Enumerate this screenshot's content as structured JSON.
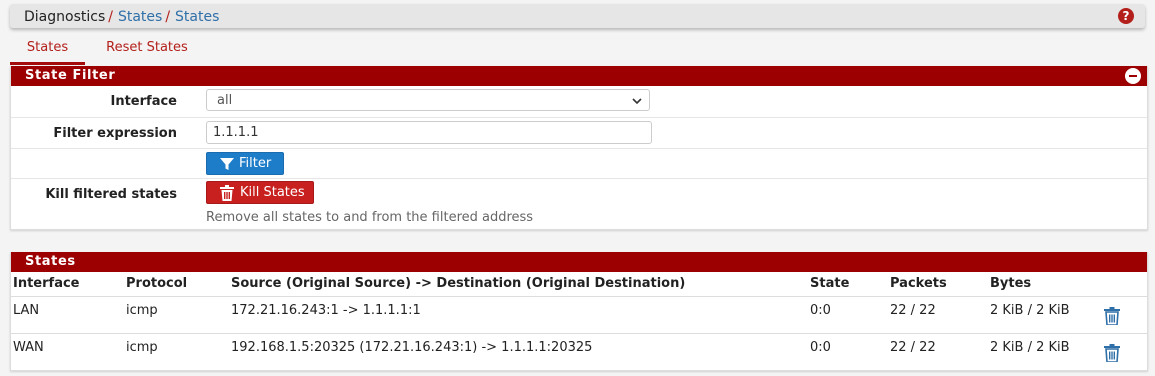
{
  "breadcrumb": {
    "items": [
      "Diagnostics",
      "States",
      "States"
    ],
    "separator": "/"
  },
  "tabs": [
    "States",
    "Reset States"
  ],
  "state_filter": {
    "title": "State Filter",
    "interface_label": "Interface",
    "interface_value": "all",
    "filter_label": "Filter expression",
    "filter_value": "1.1.1.1",
    "filter_button": "Filter",
    "kill_label": "Kill filtered states",
    "kill_button": "Kill States",
    "kill_help": "Remove all states to and from the filtered address"
  },
  "states": {
    "title": "States",
    "columns": [
      "Interface",
      "Protocol",
      "Source (Original Source) -> Destination (Original Destination)",
      "State",
      "Packets",
      "Bytes"
    ],
    "rows": [
      {
        "interface": "LAN",
        "protocol": "icmp",
        "flow": "172.21.16.243:1 -> 1.1.1.1:1",
        "state": "0:0",
        "packets": "22 / 22",
        "bytes": "2 KiB / 2 KiB"
      },
      {
        "interface": "WAN",
        "protocol": "icmp",
        "flow": "192.168.1.5:20325 (172.21.16.243:1) -> 1.1.1.1:20325",
        "state": "0:0",
        "packets": "22 / 22",
        "bytes": "2 KiB / 2 KiB"
      }
    ]
  },
  "colors": {
    "panel_header": "#9c0000",
    "link": "#2f6fa8",
    "button_blue": "#1e7dc9",
    "button_red": "#c7201f"
  }
}
